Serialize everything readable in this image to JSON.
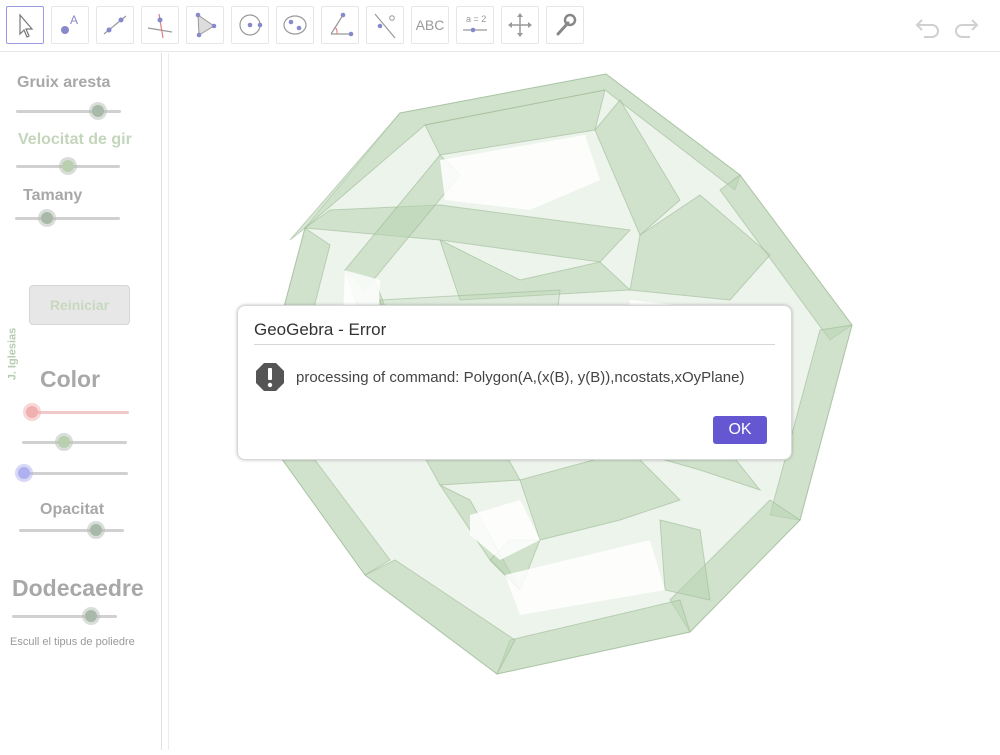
{
  "toolbar": {
    "tools": [
      {
        "name": "move-tool",
        "icon": "pointer-arrow-icon"
      },
      {
        "name": "point-tool",
        "icon": "point-icon"
      },
      {
        "name": "line-tool",
        "icon": "line-icon"
      },
      {
        "name": "perpendicular-tool",
        "icon": "perpendicular-icon"
      },
      {
        "name": "polygon-tool",
        "icon": "polygon-icon"
      },
      {
        "name": "circle-tool",
        "icon": "circle-icon"
      },
      {
        "name": "conic-tool",
        "icon": "conic-icon"
      },
      {
        "name": "angle-tool",
        "icon": "angle-icon"
      },
      {
        "name": "reflect-tool",
        "icon": "reflect-icon"
      },
      {
        "name": "text-tool",
        "icon": "text-icon",
        "label": "ABC"
      },
      {
        "name": "slider-tool",
        "icon": "slider-icon",
        "label": "a = 2"
      },
      {
        "name": "move-graphics-tool",
        "icon": "move-cross-icon"
      },
      {
        "name": "properties-tool",
        "icon": "wrench-icon"
      }
    ],
    "undo_icon": "undo-icon",
    "redo_icon": "redo-icon"
  },
  "sidebar": {
    "edge_width_label": "Gruix aresta",
    "edge_width_value": 0.78,
    "speed_label": "Velocitat de gir",
    "speed_value": 0.5,
    "size_label": "Tamany",
    "size_value": 0.3,
    "credit": "J. Iglesias",
    "reset_label": "Reiniciar",
    "color_label": "Color",
    "red_value": 0.06,
    "green_value": 0.4,
    "blue_value": 0.0,
    "opacity_label": "Opacitat",
    "opacity_value": 0.73,
    "polyhedron_label": "Dodecaedre",
    "polyhedron_value": 0.75,
    "polyhedron_hint": "Escull el tipus de poliedre"
  },
  "colors": {
    "accent": "#6557d2",
    "shape_fill": "#b9d3b2",
    "shape_dark": "#9fbb98"
  },
  "dialog": {
    "title": "GeoGebra - Error",
    "message": "processing of command: Polygon(A,(x(B), y(B)),ncostats,xOyPlane)",
    "ok_label": "OK",
    "icon": "exclamation-icon"
  }
}
